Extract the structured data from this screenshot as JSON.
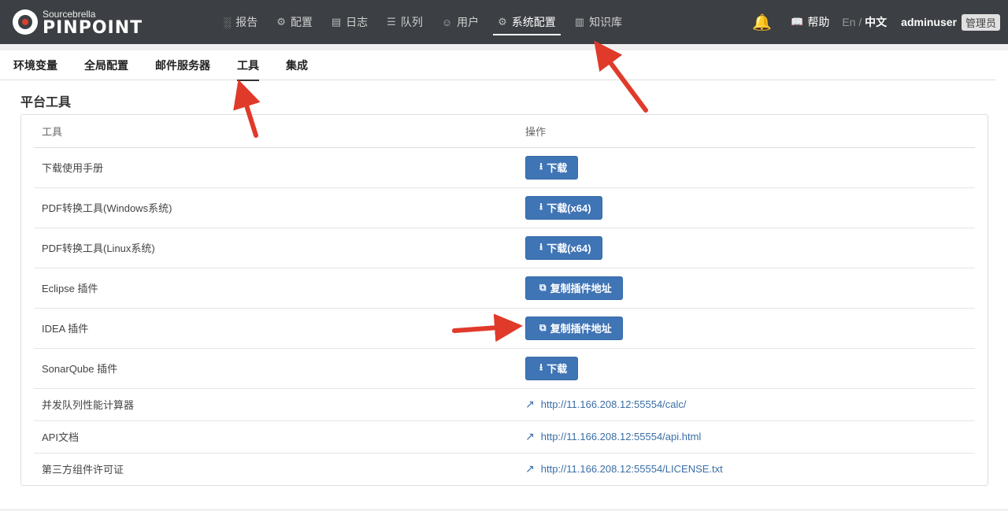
{
  "brand": {
    "top": "Sourcebrella",
    "name": "PINPOINT"
  },
  "nav": {
    "items": [
      {
        "label": "报告",
        "icon": "bar-chart-icon"
      },
      {
        "label": "配置",
        "icon": "gear-icon"
      },
      {
        "label": "日志",
        "icon": "document-icon"
      },
      {
        "label": "队列",
        "icon": "list-icon"
      },
      {
        "label": "用户",
        "icon": "users-icon"
      },
      {
        "label": "系统配置",
        "icon": "gear-icon",
        "active": true
      },
      {
        "label": "知识库",
        "icon": "book-icon"
      }
    ],
    "help_label": "帮助",
    "lang_en": "En",
    "lang_sep": " / ",
    "lang_zh": "中文",
    "username": "adminuser",
    "role": "管理员"
  },
  "tabs": [
    {
      "label": "环境变量"
    },
    {
      "label": "全局配置"
    },
    {
      "label": "邮件服务器"
    },
    {
      "label": "工具",
      "active": true
    },
    {
      "label": "集成"
    }
  ],
  "section_title": "平台工具",
  "table": {
    "headers": [
      "工具",
      "操作"
    ],
    "rows": [
      {
        "tool": "下载使用手册",
        "action": {
          "type": "button",
          "icon": "download-icon",
          "label": "下载"
        }
      },
      {
        "tool": "PDF转换工具(Windows系统)",
        "action": {
          "type": "button",
          "icon": "download-icon",
          "label": "下载(x64)"
        }
      },
      {
        "tool": "PDF转换工具(Linux系统)",
        "action": {
          "type": "button",
          "icon": "download-icon",
          "label": "下载(x64)"
        }
      },
      {
        "tool": "Eclipse 插件",
        "action": {
          "type": "button",
          "icon": "copy-icon",
          "label": "复制插件地址"
        }
      },
      {
        "tool": "IDEA 插件",
        "action": {
          "type": "button",
          "icon": "copy-icon",
          "label": "复制插件地址"
        }
      },
      {
        "tool": "SonarQube 插件",
        "action": {
          "type": "button",
          "icon": "download-icon",
          "label": "下载"
        }
      },
      {
        "tool": "并发队列性能计算器",
        "action": {
          "type": "link",
          "icon": "external-link-icon",
          "label": "http://11.166.208.12:55554/calc/"
        }
      },
      {
        "tool": "API文档",
        "action": {
          "type": "link",
          "icon": "external-link-icon",
          "label": "http://11.166.208.12:55554/api.html"
        }
      },
      {
        "tool": "第三方组件许可证",
        "action": {
          "type": "link",
          "icon": "external-link-icon",
          "label": "http://11.166.208.12:55554/LICENSE.txt"
        }
      }
    ]
  },
  "colors": {
    "topbar": "#3c3f43",
    "button": "#3f74b5",
    "link": "#3a6ea5",
    "annotation_arrow": "#e03a2a"
  }
}
